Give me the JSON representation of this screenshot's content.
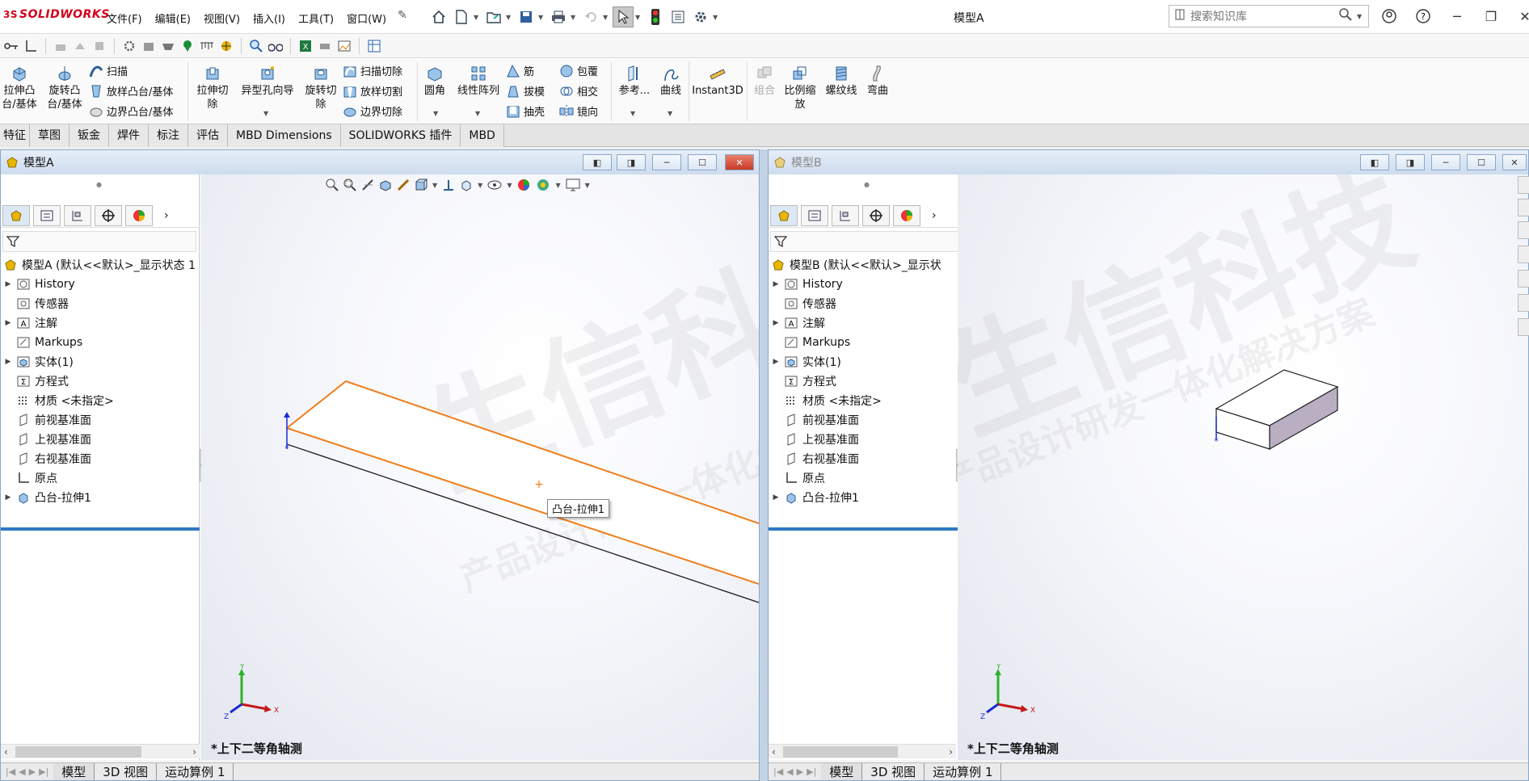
{
  "app": {
    "logo_prefix": "3S",
    "logo_text": "SOLIDWORKS",
    "document_title": "模型A"
  },
  "menu": [
    "文件(F)",
    "编辑(E)",
    "视图(V)",
    "插入(I)",
    "工具(T)",
    "窗口(W)"
  ],
  "search": {
    "placeholder": "搜索知识库"
  },
  "ribbon": {
    "extrude_boss": "拉伸凸\n台/基体",
    "revolve_boss": "旋转凸\n台/基体",
    "sweep": "扫描",
    "loft_boss": "放样凸台/基体",
    "boundary_boss": "边界凸台/基体",
    "extrude_cut": "拉伸切\n除",
    "hole_wizard": "异型孔向导",
    "revolve_cut": "旋转切\n除",
    "swept_cut": "扫描切除",
    "lofted_cut": "放样切割",
    "boundary_cut": "边界切除",
    "fillet": "圆角",
    "linear_pattern": "线性阵列",
    "rib": "筋",
    "draft": "拔模",
    "shell": "抽壳",
    "wrap": "包覆",
    "intersect": "相交",
    "mirror": "镜向",
    "reference": "参考...",
    "curves": "曲线",
    "instant3d": "Instant3D",
    "combine": "组合",
    "scale": "比例缩\n放",
    "thread": "螺纹线",
    "flex": "弯曲"
  },
  "command_tabs": [
    "特征",
    "草图",
    "钣金",
    "焊件",
    "标注",
    "评估",
    "MBD Dimensions",
    "SOLIDWORKS 插件",
    "MBD"
  ],
  "windowA": {
    "title": "模型A",
    "root": "模型A  (默认<<默认>_显示状态 1",
    "tree": [
      "History",
      "传感器",
      "注解",
      "Markups",
      "实体(1)",
      "方程式",
      "材质 <未指定>",
      "前视基准面",
      "上视基准面",
      "右视基准面",
      "原点",
      "凸台-拉伸1"
    ],
    "view_name": "*上下二等角轴测",
    "tooltip": "凸台-拉伸1",
    "bottom_tabs": [
      "模型",
      "3D 视图",
      "运动算例 1"
    ]
  },
  "windowB": {
    "title": "模型B",
    "root": "模型B  (默认<<默认>_显示状",
    "tree": [
      "History",
      "传感器",
      "注解",
      "Markups",
      "实体(1)",
      "方程式",
      "材质 <未指定>",
      "前视基准面",
      "上视基准面",
      "右视基准面",
      "原点",
      "凸台-拉伸1"
    ],
    "view_name": "*上下二等角轴测",
    "bottom_tabs": [
      "模型",
      "3D 视图",
      "运动算例 1"
    ]
  },
  "triad": {
    "x": "X",
    "y": "Y",
    "z": "Z"
  },
  "watermark": {
    "main": "生信科技",
    "sub": "产品设计研发一体化解决方案"
  },
  "colors": {
    "accent": "#2f78c4",
    "selection": "#f07d1a",
    "brand": "#d4001a"
  }
}
